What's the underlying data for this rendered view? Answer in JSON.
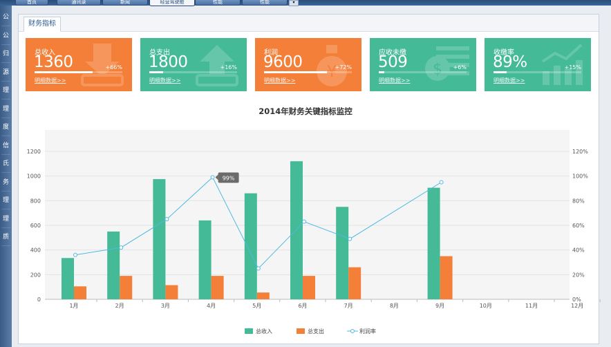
{
  "top_tabs": [
    {
      "label": "首页",
      "active": false
    },
    {
      "label": "通讯录",
      "active": false
    },
    {
      "label": "新闻",
      "active": false
    },
    {
      "label": "经营驾驶舱",
      "active": true
    },
    {
      "label": "性能",
      "active": false
    },
    {
      "label": "性能",
      "active": false
    }
  ],
  "sidebar": {
    "items": [
      "公",
      "公",
      "归",
      "源",
      "理",
      "理",
      "度",
      "信",
      "氏",
      "务",
      "理",
      "理",
      "质"
    ]
  },
  "panel": {
    "tab_label": "财务指标"
  },
  "cards": [
    {
      "label": "总收入",
      "value": "1360",
      "change": "+66%",
      "progress": 0.66,
      "link": "明细数据>>",
      "color": "#f47f38",
      "icon": "down-arrow-icon"
    },
    {
      "label": "总支出",
      "value": "1800",
      "change": "+16%",
      "progress": 0.16,
      "link": "明细数据>>",
      "color": "#44ba96",
      "icon": "up-arrow-icon"
    },
    {
      "label": "利润",
      "value": "9600",
      "change": "+72%",
      "progress": 0.72,
      "link": "明细数据>>",
      "color": "#f47f38",
      "icon": "money-bag-icon"
    },
    {
      "label": "应收未缴",
      "value": "509",
      "change": "+6%",
      "progress": 0.06,
      "link": "明细数据>>",
      "color": "#44ba96",
      "icon": "dollar-coin-icon"
    },
    {
      "label": "收缴率",
      "value": "89%",
      "change": "+15%",
      "progress": 0.15,
      "link": "明细数据>>",
      "color": "#44ba96",
      "icon": "trend-chart-icon"
    }
  ],
  "chart_data": {
    "type": "bar",
    "title": "2014年财务关键指标监控",
    "categories": [
      "1月",
      "2月",
      "3月",
      "4月",
      "5月",
      "6月",
      "7月",
      "8月",
      "9月",
      "10月",
      "11月",
      "12月"
    ],
    "series": [
      {
        "name": "总收入",
        "kind": "bar",
        "axis": "left",
        "color": "#44ba96",
        "values": [
          335,
          550,
          975,
          640,
          860,
          1120,
          750,
          null,
          905,
          null,
          null,
          null
        ]
      },
      {
        "name": "总支出",
        "kind": "bar",
        "axis": "left",
        "color": "#f47f38",
        "values": [
          105,
          190,
          115,
          190,
          55,
          190,
          260,
          null,
          350,
          null,
          null,
          null
        ]
      },
      {
        "name": "利润率",
        "kind": "line",
        "axis": "right",
        "color": "#4fb9e3",
        "values": [
          0.36,
          0.42,
          0.65,
          0.99,
          0.25,
          0.63,
          0.49,
          null,
          0.95,
          null,
          null,
          null
        ]
      }
    ],
    "y_left": {
      "min": 0,
      "max": 1200,
      "ticks": [
        0,
        200,
        400,
        600,
        800,
        1000,
        1200
      ]
    },
    "y_right": {
      "min": 0,
      "max": 1.2,
      "ticks": [
        "0%",
        "20%",
        "40%",
        "60%",
        "80%",
        "100%",
        "120%"
      ]
    },
    "tooltip": {
      "category_index": 3,
      "text": "99%"
    },
    "grid": true,
    "legend_position": "bottom"
  }
}
